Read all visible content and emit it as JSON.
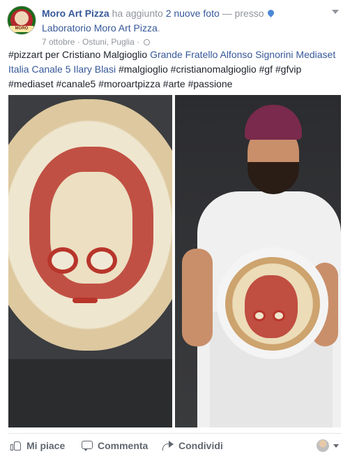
{
  "post": {
    "page_name": "Moro Art Pizza",
    "added_text": "ha aggiunto",
    "photos_count_link": "2 nuove foto",
    "dash_text": "—",
    "at_text": "presso",
    "location_name": "Laboratorio Moro Art Pizza",
    "period": ".",
    "date": "7 ottobre",
    "dot": " · ",
    "place": "Ostuni, Puglia",
    "audience_icon": "globe-icon",
    "avatar_badge": "MORO",
    "caption": {
      "t1": "#pizzart per Cristiano Malgioglio ",
      "l1": "Grande Fratello Alfonso Signorini Mediaset Italia Canale 5 Ilary Blasi",
      "t2": " #malgioglio #cristianomalgioglio #gf #gfvip #mediaset #canale5 #moroartpizza #arte #passione"
    },
    "photos": [
      {
        "alt": "pizza portrait"
      },
      {
        "alt": "chef holding pizza"
      }
    ]
  },
  "actions": {
    "like": "Mi piace",
    "comment": "Commenta",
    "share": "Condividi"
  },
  "colors": {
    "link": "#365899",
    "text": "#1d2129",
    "meta": "#90949c",
    "action": "#616770"
  }
}
